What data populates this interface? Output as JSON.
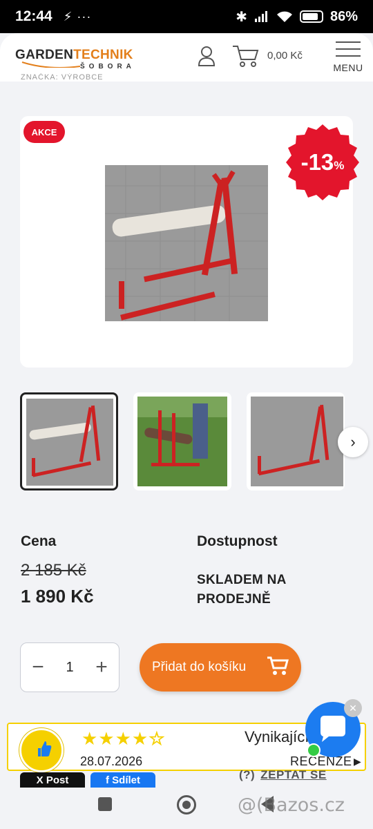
{
  "statusbar": {
    "time": "12:44",
    "extra_icons": "⚡ ···",
    "battery": "86%"
  },
  "header": {
    "logo_part1": "GARDEN",
    "logo_part2": "TECHNIK",
    "logo_sub": "ŠOBORA",
    "cart_total": "0,00 Kč",
    "menu_label": "MENU"
  },
  "breadcrumb_cut": "ZNAČKA: VÝROBCE",
  "product": {
    "badge_akce": "AKCE",
    "discount_value": "-13",
    "discount_unit": "%",
    "price_heading": "Cena",
    "old_price": "2 185 Kč",
    "new_price": "1 890 Kč",
    "availability_heading": "Dostupnost",
    "availability_value": "SKLADEM NA PRODEJNĚ",
    "quantity": "1",
    "qty_minus": "−",
    "qty_plus": "+",
    "add_to_cart": "Přidat do košíku"
  },
  "gallery": {
    "next": "›"
  },
  "review_badge": {
    "stars_filled": "★★★★",
    "stars_empty": "☆",
    "rating_word": "Vynikající",
    "date": "28.07.2026",
    "reviews_label": "RECENZE",
    "arrow": "▶"
  },
  "chat": {
    "close": "✕"
  },
  "share": {
    "x_label": "X  Post",
    "fb_label": "f  Sdílet"
  },
  "ask": {
    "mark": "(?)",
    "label": "ZEPTAT SE"
  },
  "watermark": "@(Bazos.cz"
}
